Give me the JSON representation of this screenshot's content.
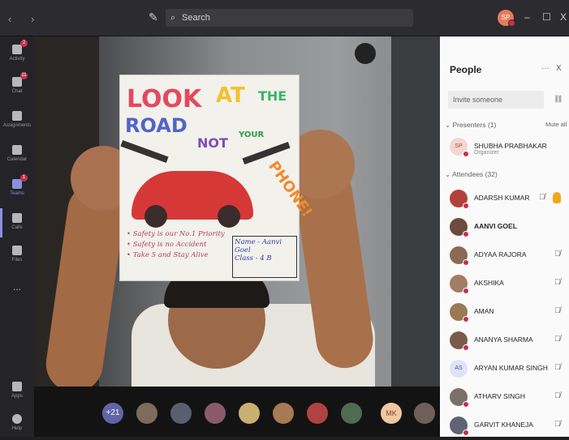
{
  "topbar": {
    "search_placeholder": "Search",
    "user_initials": "SP",
    "window_controls": [
      "–",
      "☐",
      "X"
    ]
  },
  "rail": {
    "items": [
      {
        "label": "Activity",
        "icon": "bell-icon",
        "badge": "2"
      },
      {
        "label": "Chat",
        "icon": "chat-icon",
        "badge": "11"
      },
      {
        "label": "Assignments",
        "icon": "assignments-icon",
        "badge": ""
      },
      {
        "label": "Calendar",
        "icon": "calendar-icon",
        "badge": ""
      },
      {
        "label": "Teams",
        "icon": "teams-icon",
        "badge": "1"
      },
      {
        "label": "Calls",
        "icon": "phone-icon",
        "badge": ""
      },
      {
        "label": "Files",
        "icon": "file-icon",
        "badge": ""
      },
      {
        "label": "...",
        "icon": "more-icon",
        "badge": ""
      },
      {
        "label": "Apps",
        "icon": "apps-icon",
        "badge": ""
      },
      {
        "label": "Help",
        "icon": "help-icon",
        "badge": ""
      }
    ]
  },
  "video": {
    "poster": {
      "look": "LOOK",
      "at": "AT",
      "the": "THE",
      "road": "ROAD",
      "not": "NOT",
      "your": "YOUR",
      "phone": "PHONE!",
      "slogan": [
        "• Safety is our No.1 Priority",
        "• Safety is no Accident",
        "• Take 5 and Stay Alive"
      ],
      "name_line": "Name - Aanvi Goel",
      "class_line": "Class - 4 B"
    }
  },
  "strip": {
    "more_count": "+21",
    "mk_initials": "MK"
  },
  "panel": {
    "title": "People",
    "more": "···",
    "close": "X",
    "invite_placeholder": "Invite someone",
    "presenters_header": "Presenters (1)",
    "mute_all": "Mute all",
    "attendees_header": "Attendees (32)",
    "presenter": {
      "initials": "SP",
      "name": "SHUBHA PRABHAKAR",
      "role": "Organizer"
    },
    "attendees": [
      {
        "name": "ADARSH KUMAR",
        "color": "#b3413a",
        "hand": true
      },
      {
        "name": "AANVI GOEL",
        "color": "#6d4b3e",
        "hand": false,
        "bold": true
      },
      {
        "name": "ADYAA RAJORA",
        "color": "#8a6a55",
        "hand": false
      },
      {
        "name": "AKSHIKA",
        "color": "#a37c64",
        "hand": false
      },
      {
        "name": "AMAN",
        "color": "#9a7a52",
        "hand": false
      },
      {
        "name": "ANANYA SHARMA",
        "color": "#7b5a4a",
        "hand": false
      },
      {
        "name": "ARYAN KUMAR SINGH",
        "color": "#dfe3f6",
        "hand": false,
        "initials": "AS"
      },
      {
        "name": "ATHARV SINGH",
        "color": "#7a6f6a",
        "hand": false
      },
      {
        "name": "GARVIT KHANEJA",
        "color": "#5e6474",
        "hand": false
      }
    ]
  }
}
